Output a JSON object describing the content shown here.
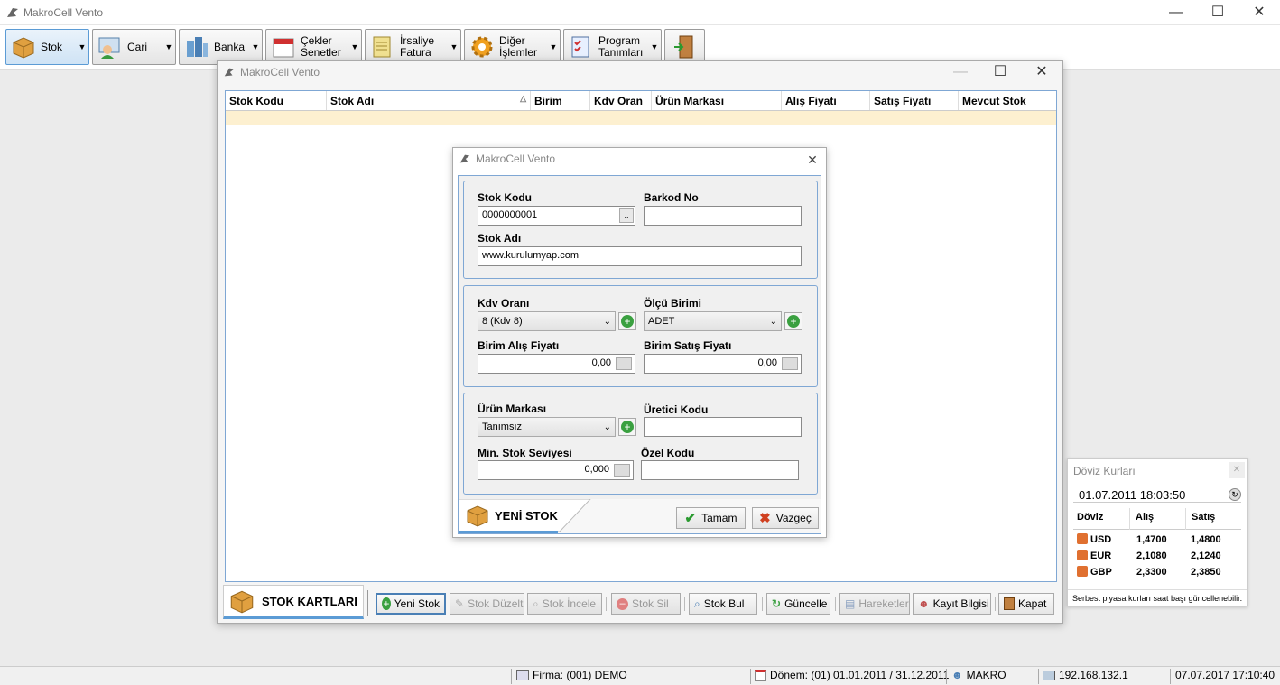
{
  "app": {
    "title": "MakroCell Vento"
  },
  "window_controls": {
    "minimize": "—",
    "maximize": "☐",
    "close": "✕"
  },
  "toolbar": {
    "stok": "Stok",
    "cari": "Cari",
    "banka": "Banka",
    "cekler_1": "Çekler",
    "cekler_2": "Senetler",
    "irsaliye_1": "İrsaliye",
    "irsaliye_2": "Fatura",
    "diger_1": "Diğer",
    "diger_2": "İşlemler",
    "program_1": "Program",
    "program_2": "Tanımları"
  },
  "stok_window": {
    "title": "MakroCell Vento",
    "columns": [
      "Stok Kodu",
      "Stok Adı",
      "Birim",
      "Kdv Oran",
      "Ürün Markası",
      "Alış Fiyatı",
      "Satış Fiyatı",
      "Mevcut Stok"
    ],
    "tab_label": "STOK KARTLARI",
    "buttons": {
      "yeni": "Yeni Stok",
      "duzelt": "Stok Düzelt",
      "incele": "Stok İncele",
      "sil": "Stok Sil",
      "bul": "Stok Bul",
      "guncelle": "Güncelle",
      "hareketler": "Hareketler",
      "kayit": "Kayıt Bilgisi",
      "kapat": "Kapat"
    }
  },
  "dialog": {
    "title": "MakroCell Vento",
    "stok_kodu_label": "Stok Kodu",
    "stok_kodu_value": "0000000001",
    "ellipsis": "..",
    "barkod_label": "Barkod No",
    "barkod_value": "",
    "stok_adi_label": "Stok Adı",
    "stok_adi_value": "www.kurulumyap.com",
    "kdv_label": "Kdv Oranı",
    "kdv_value": "8 (Kdv 8)",
    "olcu_label": "Ölçü Birimi",
    "olcu_value": "ADET",
    "alis_label": "Birim Alış Fiyatı",
    "alis_value": "0,00",
    "satis_label": "Birim Satış Fiyatı",
    "satis_value": "0,00",
    "marka_label": "Ürün Markası",
    "marka_value": "Tanımsız",
    "uretici_label": "Üretici Kodu",
    "uretici_value": "",
    "min_label": "Min. Stok Seviyesi",
    "min_value": "0,000",
    "ozel_label": "Özel Kodu",
    "ozel_value": "",
    "tab_label": "YENİ STOK",
    "ok_label": "Tamam",
    "cancel_label": "Vazgeç"
  },
  "doviz": {
    "title": "Döviz Kurları",
    "datetime": "01.07.2011 18:03:50",
    "headers": [
      "Döviz",
      "Alış",
      "Satış"
    ],
    "rows": [
      {
        "code": "USD",
        "alis": "1,4700",
        "satis": "1,4800"
      },
      {
        "code": "EUR",
        "alis": "2,1080",
        "satis": "2,1240"
      },
      {
        "code": "GBP",
        "alis": "2,3300",
        "satis": "2,3850"
      }
    ],
    "note": "Serbest piyasa kurları saat başı güncellenebilir."
  },
  "status": {
    "firma": "Firma: (001) DEMO",
    "donem": "Dönem: (01) 01.01.2011 / 31.12.2011",
    "user": "MAKRO",
    "ip": "192.168.132.1",
    "datetime": "07.07.2017 17:10:40"
  },
  "colors": {
    "accent": "#5b9bd5",
    "row_highlight": "#fdf0d0",
    "group_border": "#7fa7d4"
  }
}
